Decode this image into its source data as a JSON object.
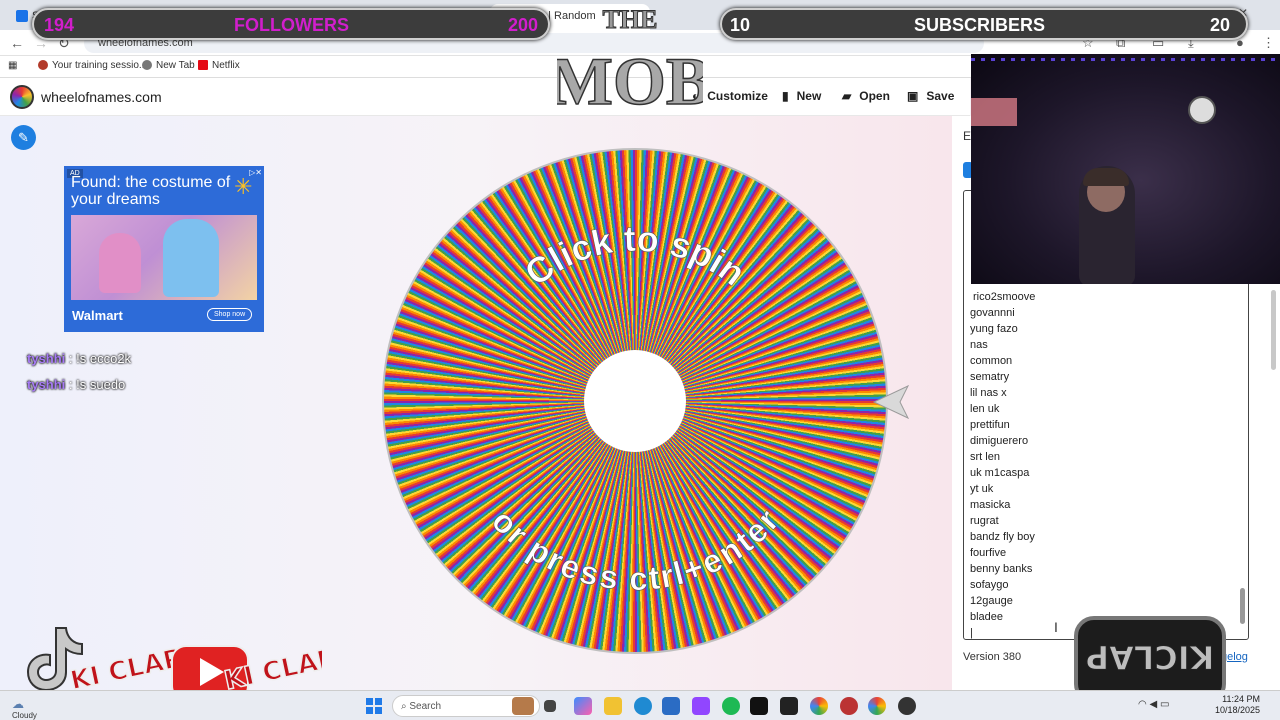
{
  "browser": {
    "tabs": [
      {
        "label": "S"
      },
      {
        "label": "of Names | Random"
      }
    ],
    "url": "wheelofnames.com",
    "bookmarks": [
      {
        "label": "Your training sessio..."
      },
      {
        "label": "New Tab"
      },
      {
        "label": "Netflix"
      }
    ]
  },
  "site": {
    "name": "wheelofnames.com",
    "buttons": {
      "customize": "Customize",
      "new": "New",
      "open": "Open",
      "save": "Save"
    }
  },
  "ad": {
    "tag": "AD",
    "headline": "Found: the costume of your dreams",
    "brand": "Walmart",
    "cta": "Shop now"
  },
  "chat": [
    {
      "user": "tyshhi",
      "message": " : !s ecco2k"
    },
    {
      "user": "tyshhi",
      "message": " : !s suedo"
    }
  ],
  "wheel": {
    "top_text": "Click to spin",
    "bottom_text": "or press ctrl+enter"
  },
  "entries": {
    "tab_label": "E",
    "items": [
      "rico2smoove",
      "govannni",
      "yung fazo",
      "nas",
      "common",
      "sematry",
      "lil nas x",
      "len uk",
      "prettifun",
      "dimiguerero",
      "srt len",
      "uk m1caspa",
      "yt uk",
      "masicka",
      "rugrat",
      "bandz fly boy",
      "fourfive",
      "benny banks",
      "sofaygo",
      "12gauge",
      "bladee"
    ],
    "version": "Version 380",
    "changelog": "gelog"
  },
  "overlay": {
    "followers": {
      "current": "194",
      "label": "FOLLOWERS",
      "goal": "200"
    },
    "subscribers": {
      "current": "10",
      "label": "SUBSCRIBERS",
      "goal": "20"
    },
    "logo_top": "THE",
    "logo_main": "MOB",
    "brand_tag": "KICLAP",
    "social_handle": "KI CLAP"
  },
  "taskbar": {
    "weather": "Cloudy",
    "search_placeholder": "Search",
    "time": "11:24 PM",
    "date": "10/18/2025"
  },
  "colors": {
    "accent": "#1e7fe0",
    "followers_text": "#d11ecc"
  }
}
